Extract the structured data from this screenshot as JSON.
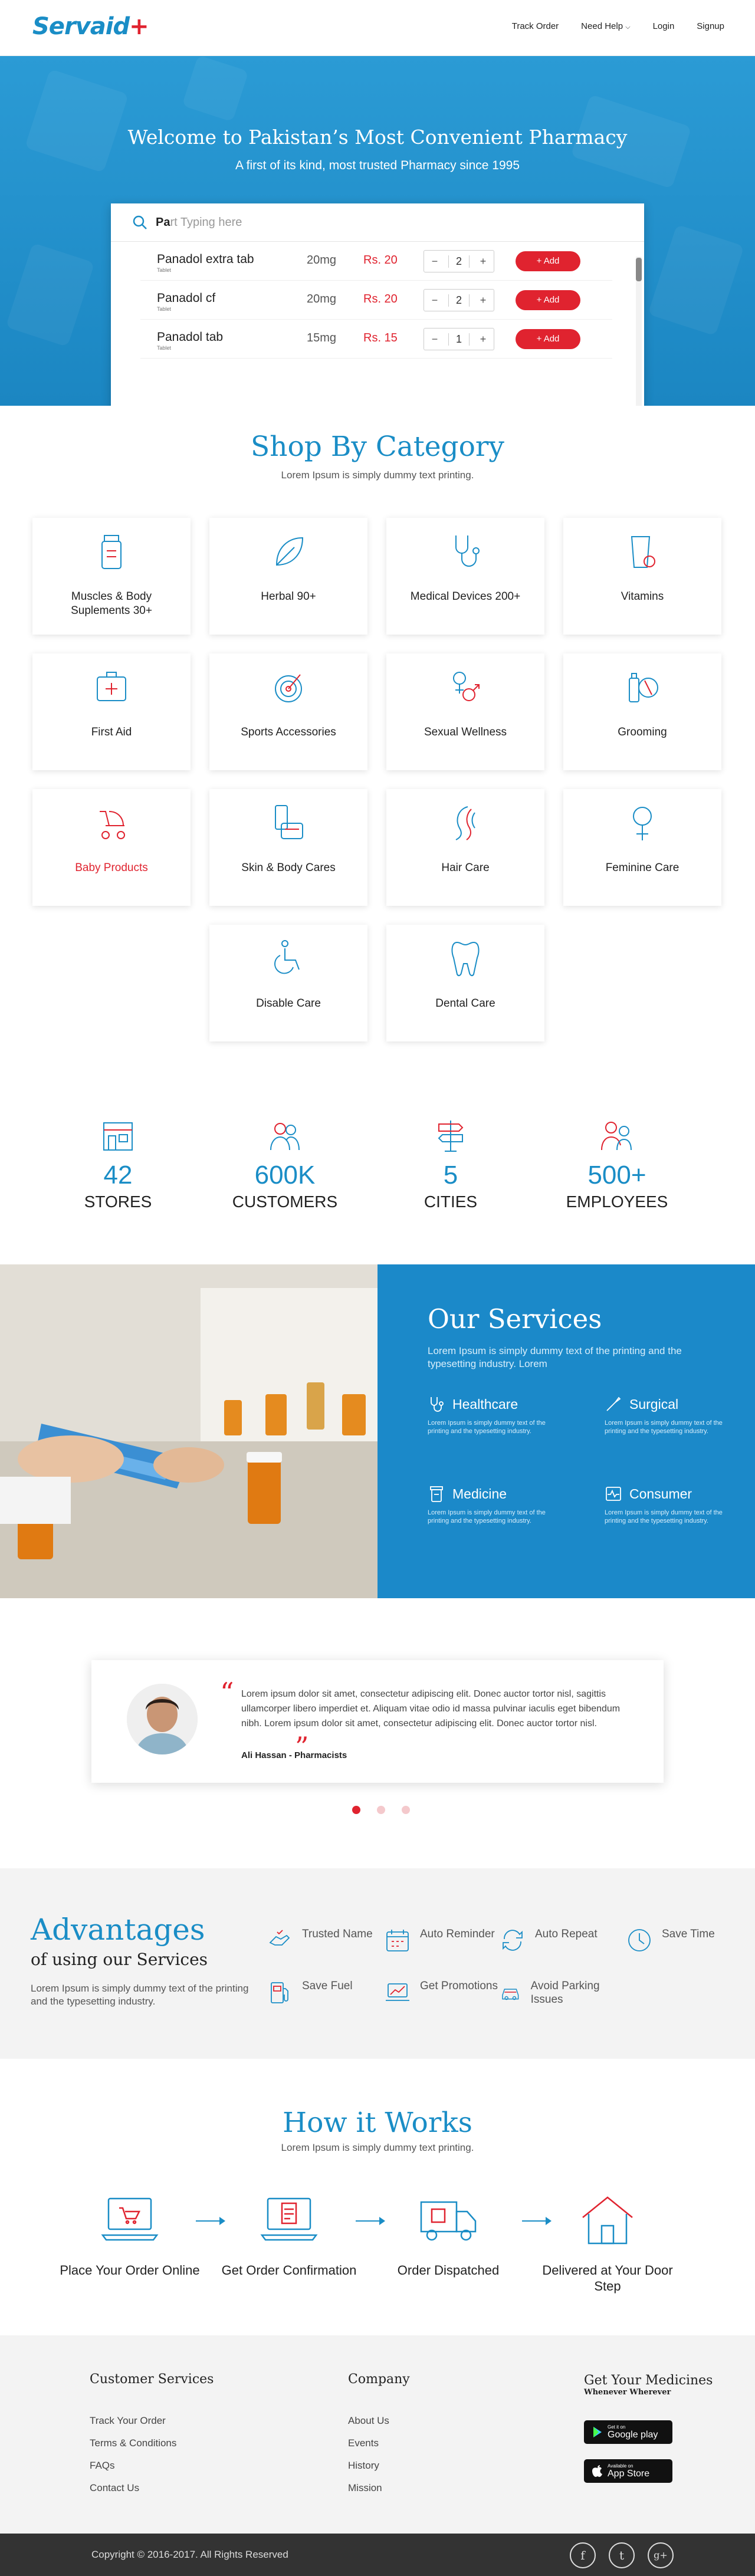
{
  "header": {
    "logo_text": "Servaid",
    "logo_plus": "+",
    "nav": [
      "Track Order",
      "Need Help",
      "Login",
      "Signup"
    ]
  },
  "hero": {
    "title": "Welcome to Pakistan’s Most Convenient Pharmacy",
    "subtitle": "A first of its kind, most trusted Pharmacy since 1995",
    "search_typed": "Pa",
    "search_placeholder": "rt Typing here",
    "results": [
      {
        "name": "Panadol extra tab",
        "type": "Tablet",
        "mg": "20mg",
        "price": "Rs. 20",
        "qty": "2",
        "add": "+ Add"
      },
      {
        "name": "Panadol cf",
        "type": "Tablet",
        "mg": "20mg",
        "price": "Rs. 20",
        "qty": "2",
        "add": "+ Add"
      },
      {
        "name": "Panadol tab",
        "type": "Tablet",
        "mg": "15mg",
        "price": "Rs. 15",
        "qty": "1",
        "add": "+ Add"
      }
    ],
    "minus": "−",
    "plus": "+"
  },
  "categories": {
    "title": "Shop By Category",
    "subtitle": "Lorem Ipsum is simply dummy text printing.",
    "items": [
      {
        "label": "Muscles & Body Suplements 30+",
        "icon": "supplement-jar-icon"
      },
      {
        "label": "Herbal 90+",
        "icon": "leaf-icon"
      },
      {
        "label": "Medical Devices 200+",
        "icon": "stethoscope-icon"
      },
      {
        "label": "Vitamins",
        "icon": "vitamin-glass-icon"
      },
      {
        "label": "First Aid",
        "icon": "first-aid-kit-icon"
      },
      {
        "label": "Sports Accessories",
        "icon": "target-icon"
      },
      {
        "label": "Sexual Wellness",
        "icon": "gender-icon"
      },
      {
        "label": "Grooming",
        "icon": "grooming-icon"
      },
      {
        "label": "Baby Products",
        "icon": "baby-stroller-icon"
      },
      {
        "label": "Skin & Body Cares",
        "icon": "skincare-bottle-icon"
      },
      {
        "label": "Hair Care",
        "icon": "hair-icon"
      },
      {
        "label": "Feminine Care",
        "icon": "female-symbol-icon"
      },
      {
        "label": "Disable Care",
        "icon": "wheelchair-icon"
      },
      {
        "label": "Dental Care",
        "icon": "tooth-icon"
      }
    ]
  },
  "stats": [
    {
      "num": "42",
      "cap": "STORES",
      "icon": "store-icon"
    },
    {
      "num": "600K",
      "cap": "CUSTOMERS",
      "icon": "customers-icon"
    },
    {
      "num": "5",
      "cap": "CITIES",
      "icon": "signpost-icon"
    },
    {
      "num": "500+",
      "cap": "EMPLOYEES",
      "icon": "employees-icon"
    }
  ],
  "services": {
    "title": "Our Services",
    "subtitle": "Lorem Ipsum is simply dummy text of the printing and the typesetting industry. Lorem",
    "items": [
      {
        "title": "Healthcare",
        "desc": "Lorem Ipsum is simply dummy text of the printing and the typesetting industry.",
        "icon": "stethoscope-icon"
      },
      {
        "title": "Surgical",
        "desc": "Lorem Ipsum is simply dummy text of the printing and the typesetting industry.",
        "icon": "scalpel-icon"
      },
      {
        "title": "Medicine",
        "desc": "Lorem Ipsum is simply dummy text of the printing and the typesetting industry.",
        "icon": "pill-bottle-icon"
      },
      {
        "title": "Consumer",
        "desc": "Lorem Ipsum is simply dummy text of the printing and the typesetting industry.",
        "icon": "pulse-chart-icon"
      }
    ]
  },
  "testimonial": {
    "open_quote": "“",
    "close_quote": "”",
    "text": "Lorem ipsum dolor sit amet, consectetur adipiscing elit. Donec auctor tortor nisl, sagittis ullamcorper libero imperdiet et. Aliquam vitae odio id massa pulvinar iaculis eget bibendum nibh. Lorem ipsum dolor sit amet, consectetur adipiscing elit. Donec auctor tortor nisl.",
    "author": "Ali Hassan - Pharmacists"
  },
  "advantages": {
    "title": "Advantages",
    "subtitle": "of using our Services",
    "desc": "Lorem Ipsum is simply dummy text of the printing and the typesetting industry.",
    "items": [
      {
        "label": "Trusted Name",
        "icon": "trusted-hand-icon"
      },
      {
        "label": "Auto Reminder",
        "icon": "calendar-icon"
      },
      {
        "label": "Auto Repeat",
        "icon": "repeat-icon"
      },
      {
        "label": "Save Time",
        "icon": "clock-icon"
      },
      {
        "label": "Save Fuel",
        "icon": "fuel-pump-icon"
      },
      {
        "label": "Get Promotions",
        "icon": "laptop-chart-icon"
      },
      {
        "label": "Avoid Parking Issues",
        "icon": "car-icon"
      }
    ]
  },
  "how": {
    "title": "How it Works",
    "subtitle": "Lorem Ipsum is simply dummy text printing.",
    "steps": [
      {
        "label": "Place Your Order Online",
        "icon": "laptop-cart-icon"
      },
      {
        "label": "Get Order Confirmation",
        "icon": "laptop-document-icon"
      },
      {
        "label": "Order Dispatched",
        "icon": "delivery-truck-icon"
      },
      {
        "label": "Delivered at Your Door Step",
        "icon": "house-icon"
      }
    ]
  },
  "footer": {
    "customer_services": {
      "title": "Customer Services",
      "links": [
        "Track Your Order",
        "Terms & Conditions",
        "FAQs",
        "Contact Us"
      ]
    },
    "company": {
      "title": "Company",
      "links": [
        "About Us",
        "Events",
        "History",
        "Mission"
      ]
    },
    "apps": {
      "title": "Get Your Medicines",
      "tagline": "Whenever Wherever",
      "google_small": "Get it on",
      "google_big": "Google play",
      "apple_small": "Available on",
      "apple_big": "App Store"
    },
    "copyright": "Copyright © 2016-2017. All Rights Reserved",
    "social": [
      "f",
      "t",
      "g+"
    ]
  },
  "colors": {
    "primary": "#1a8dc6",
    "accent": "#e0232f",
    "dark": "#333333"
  }
}
